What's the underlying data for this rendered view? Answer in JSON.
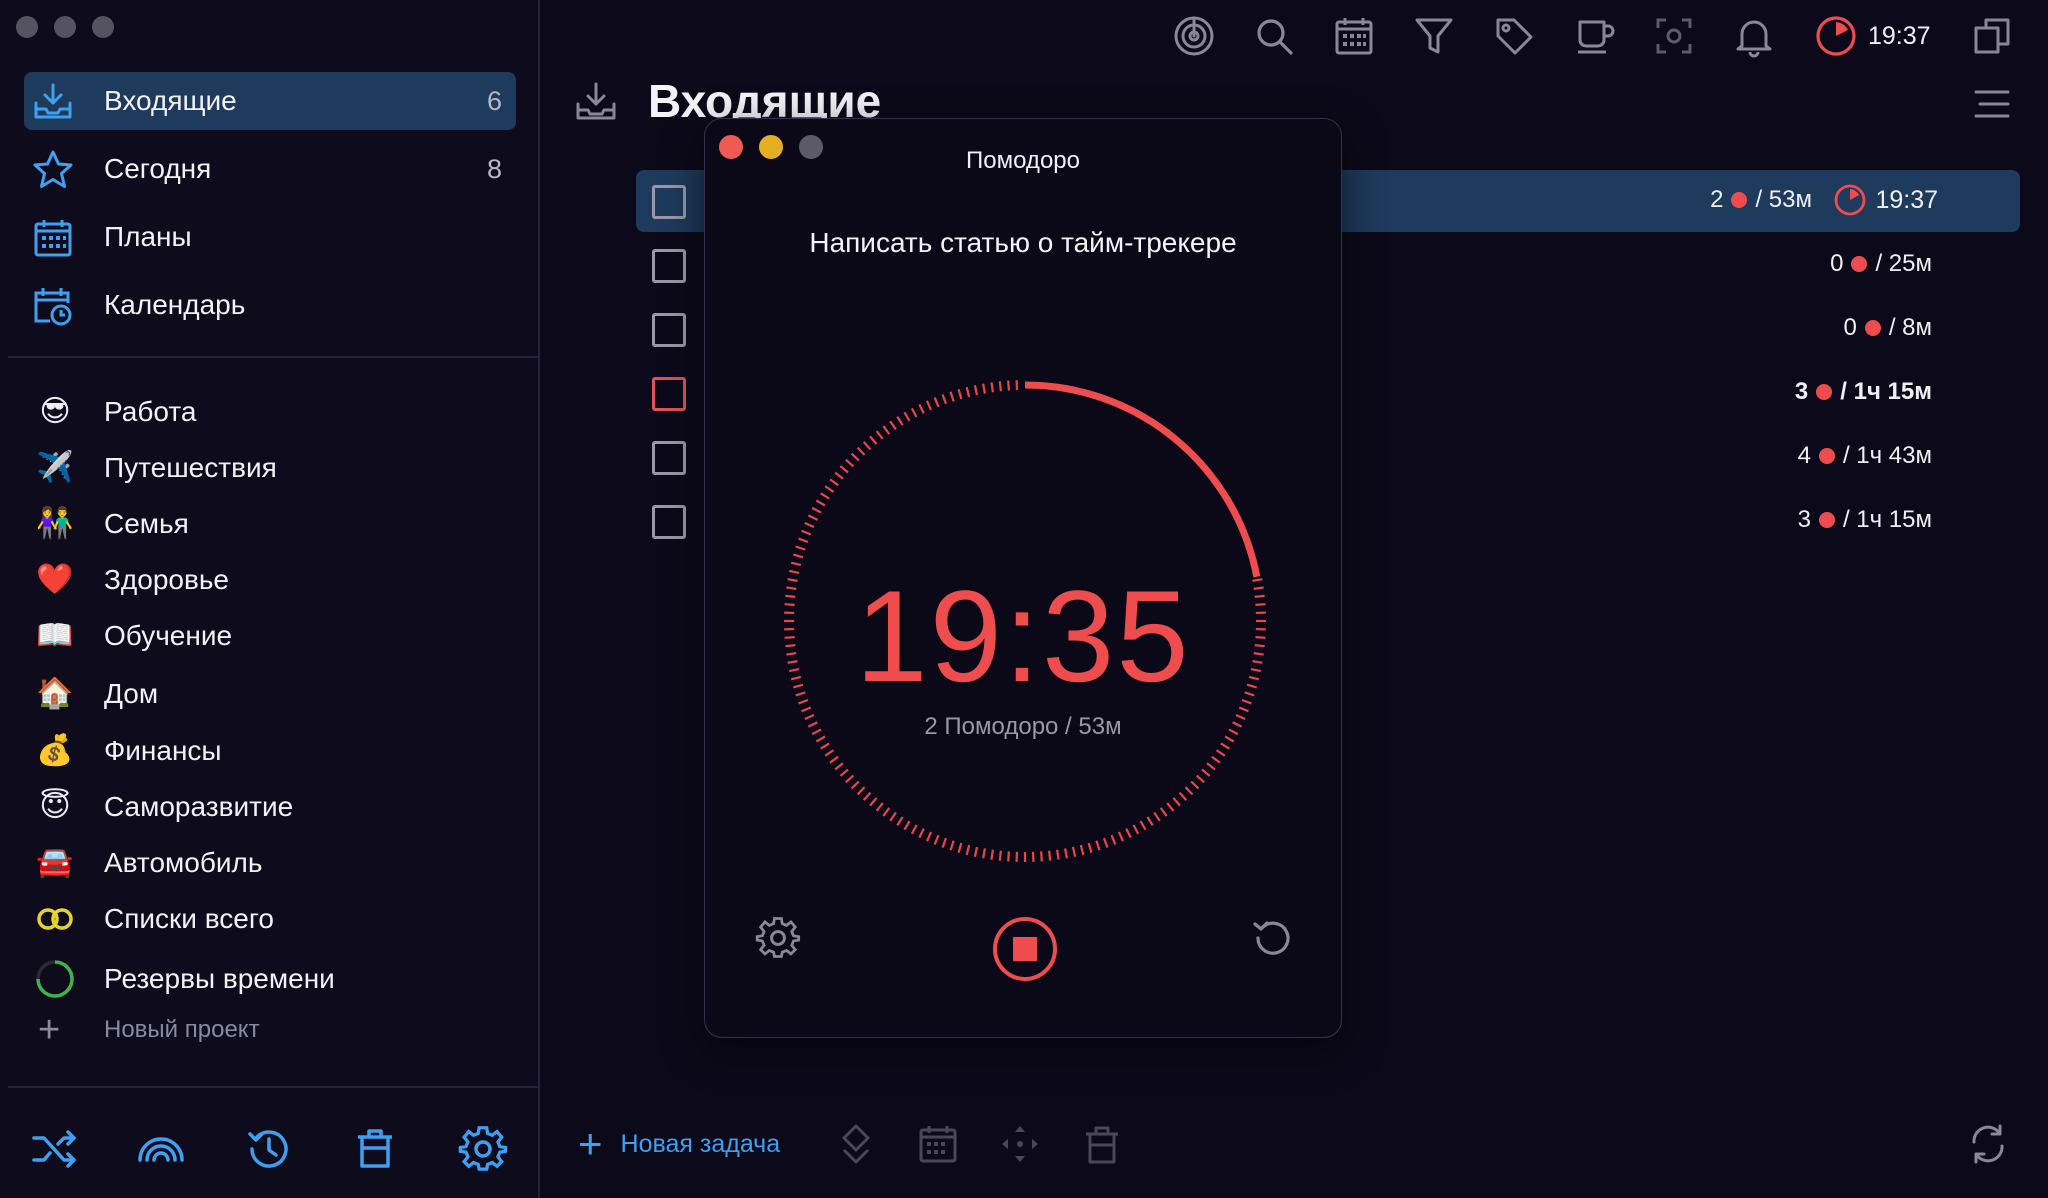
{
  "sidebar": {
    "nav": [
      {
        "label": "Входящие",
        "count": "6",
        "icon": "inbox-tray-icon",
        "active": true
      },
      {
        "label": "Сегодня",
        "count": "8",
        "icon": "star-icon"
      },
      {
        "label": "Планы",
        "count": "",
        "icon": "calendar-grid-icon"
      },
      {
        "label": "Календарь",
        "count": "",
        "icon": "calendar-clock-icon"
      }
    ],
    "projects": [
      {
        "emoji": "😎",
        "label": "Работа"
      },
      {
        "emoji": "✈️",
        "label": "Путешествия"
      },
      {
        "emoji": "👫",
        "label": "Семья"
      },
      {
        "emoji": "❤️",
        "label": "Здоровье"
      },
      {
        "emoji": "📖",
        "label": "Обучение"
      },
      {
        "emoji": "🏠",
        "label": "Дом"
      },
      {
        "emoji": "💰",
        "label": "Финансы"
      },
      {
        "emoji": "😇",
        "label": "Саморазвитие"
      },
      {
        "emoji": "🚘",
        "label": "Автомобиль"
      },
      {
        "emoji": "",
        "label": "Списки всего"
      },
      {
        "emoji": "",
        "label": "Резервы времени"
      }
    ],
    "new_project": "Новый проект"
  },
  "header": {
    "title": "Входящие",
    "timer": "19:37"
  },
  "tasks": [
    {
      "count": "2",
      "duration": "/ 53м",
      "selected": true,
      "timer": "19:37"
    },
    {
      "count": "0",
      "duration": "/ 25м"
    },
    {
      "count": "0",
      "duration": "/ 8м"
    },
    {
      "count": "3",
      "duration": "/ 1ч 15м",
      "bold": true,
      "red_checkbox": true
    },
    {
      "count": "4",
      "duration": "/ 1ч 43м"
    },
    {
      "count": "3",
      "duration": "/ 1ч 15м"
    }
  ],
  "footer": {
    "new_task": "Новая задача"
  },
  "pomodoro": {
    "window_title": "Помодоро",
    "task": "Написать статью о тайм-трекере",
    "time": "19:35",
    "summary": "2 Помодоро / 53м",
    "progress_fraction": 0.22
  },
  "colors": {
    "accent": "#3ea0f0",
    "pomodoro_red": "#ef4d4d",
    "selection": "#1e3a5c"
  }
}
